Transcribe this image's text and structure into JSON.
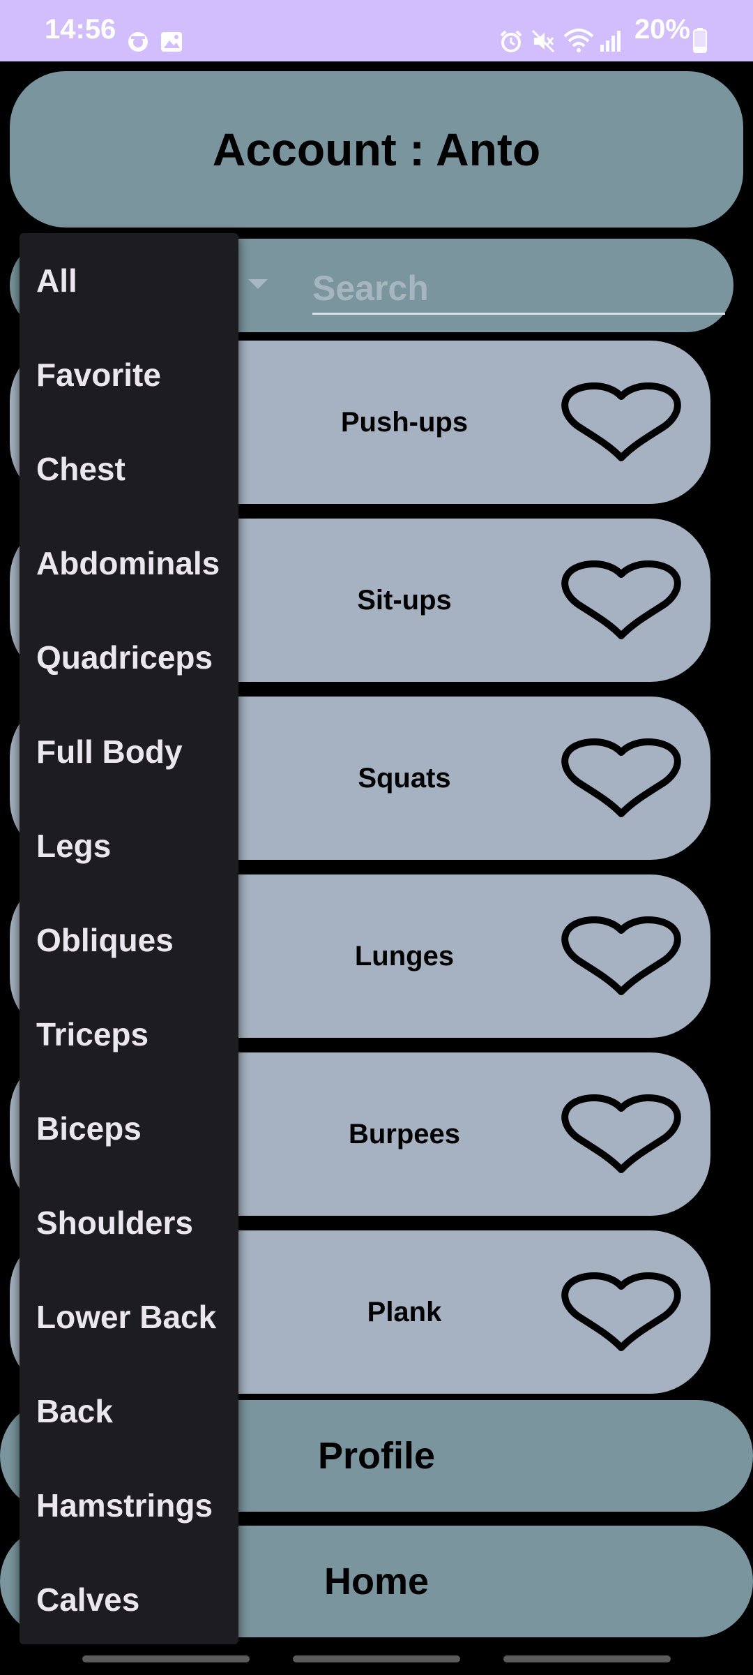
{
  "status_bar": {
    "time": "14:56",
    "battery": "20%",
    "left_icons": [
      "face-notification-icon",
      "gallery-notification-icon"
    ],
    "right_icons": [
      "alarm-icon",
      "mute-icon",
      "wifi-icon",
      "signal-icon",
      "battery-icon"
    ]
  },
  "header": {
    "account_title": "Account : Anto"
  },
  "search": {
    "placeholder": "Search",
    "value": ""
  },
  "exercises": [
    {
      "name": "Push-ups",
      "favorite": false
    },
    {
      "name": "Sit-ups",
      "favorite": false
    },
    {
      "name": "Squats",
      "favorite": false
    },
    {
      "name": "Lunges",
      "favorite": false
    },
    {
      "name": "Burpees",
      "favorite": false
    },
    {
      "name": "Plank",
      "favorite": false
    }
  ],
  "nav": {
    "profile_label": "Profile",
    "home_label": "Home"
  },
  "category_dropdown": {
    "options": [
      "All",
      "Favorite",
      "Chest",
      "Abdominals",
      "Quadriceps",
      "Full Body",
      "Legs",
      "Obliques",
      "Triceps",
      "Biceps",
      "Shoulders",
      "Lower Back",
      "Back",
      "Hamstrings",
      "Calves"
    ]
  },
  "colors": {
    "status_bar": "#d2bdfd",
    "header": "#7a959d",
    "card": "#a6b2c1",
    "dropdown": "#1d1c20",
    "background": "#000000"
  }
}
